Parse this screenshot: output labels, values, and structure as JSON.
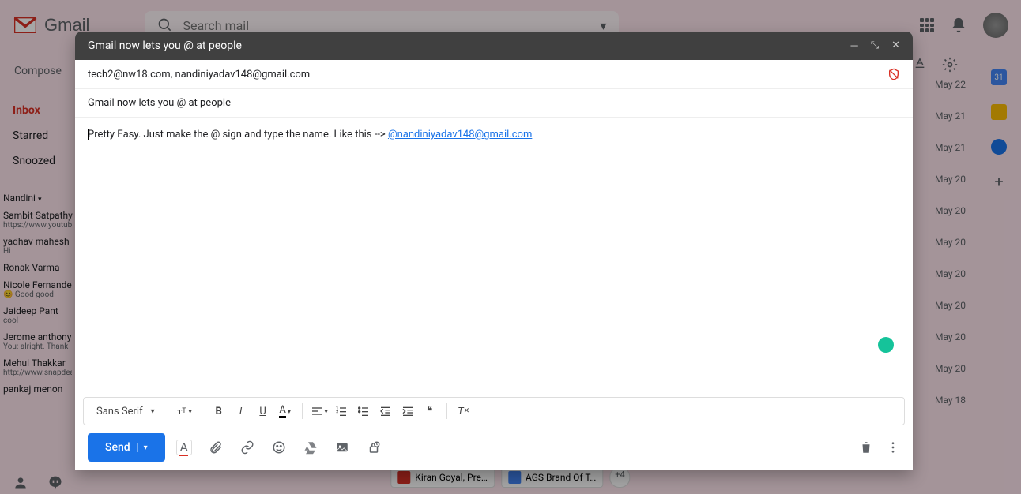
{
  "app": {
    "name": "Gmail"
  },
  "search": {
    "placeholder": "Search mail"
  },
  "compose_button": "Compose",
  "nav": {
    "inbox": "Inbox",
    "starred": "Starred",
    "snoozed": "Snoozed"
  },
  "hangouts_user": "Nandini",
  "chats": [
    {
      "name": "Sambit Satpathy",
      "sub": "https://www.youtube"
    },
    {
      "name": "yadhav mahesh",
      "sub": "Hi"
    },
    {
      "name": "Ronak Varma",
      "sub": ""
    },
    {
      "name": "Nicole Fernande",
      "sub": "😊 Good good"
    },
    {
      "name": "Jaideep Pant",
      "sub": "cool"
    },
    {
      "name": "Jerome anthony",
      "sub": "You: alright. Thank"
    },
    {
      "name": "Mehul Thakkar",
      "sub": "http://www.snapdea"
    },
    {
      "name": "pankaj menon",
      "sub": ""
    }
  ],
  "dates": [
    "May 22",
    "May 21",
    "May 21",
    "May 20",
    "May 20",
    "May 20",
    "May 20",
    "May 20",
    "May 20",
    "May 20",
    "May 18"
  ],
  "bottom_chips": [
    {
      "label": "Kiran Goyal, Pre…",
      "color": "#d93025"
    },
    {
      "label": "AGS Brand Of T…",
      "color": "#4285f4"
    }
  ],
  "chip_extra": "+4",
  "sidepanel": {
    "cal_day": "31"
  },
  "compose": {
    "title": "Gmail now lets you @ at people",
    "to": "tech2@nw18.com, nandiniyadav148@gmail.com",
    "subject": "Gmail now lets you @ at people",
    "body_prefix": "Pretty Easy. Just make the @ sign and type the name. Like this --> ",
    "body_mention": "@nandiniyadav148@gmail.com",
    "font_name": "Sans Serif",
    "send": "Send"
  }
}
